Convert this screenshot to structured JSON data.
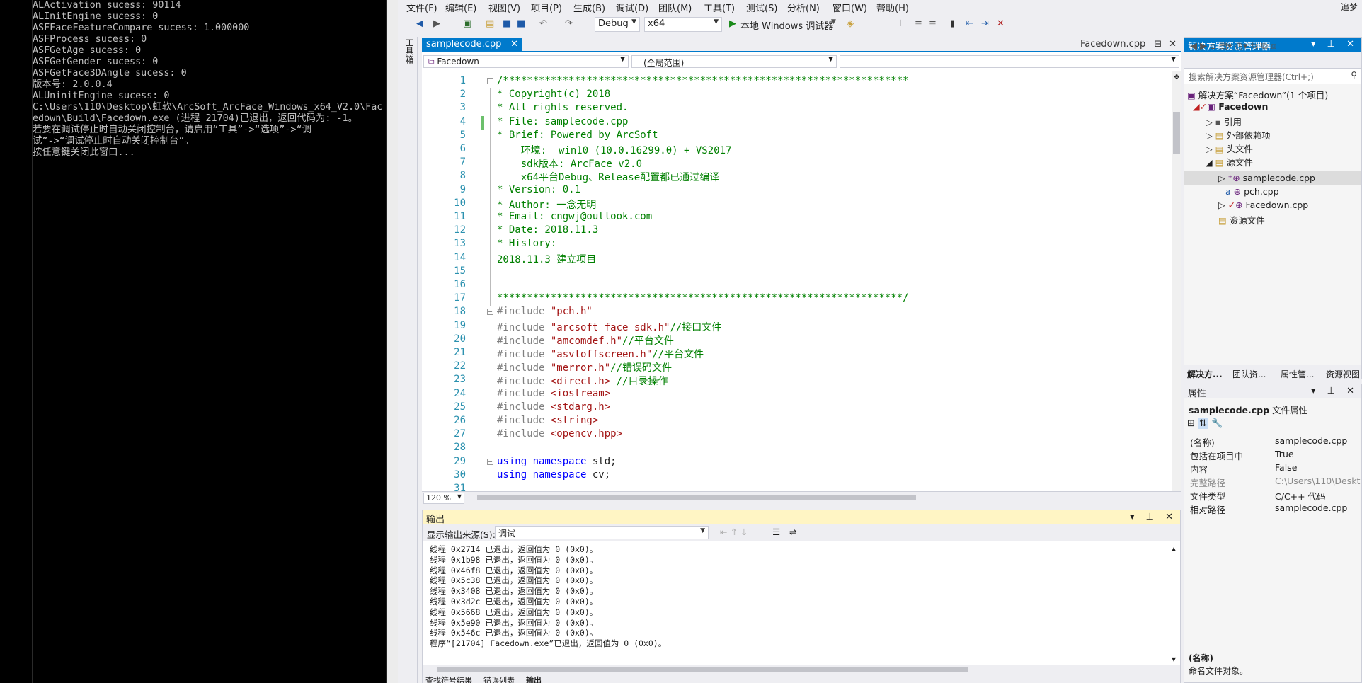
{
  "console": {
    "lines": [
      "ALActivation sucess: 90114",
      "ALInitEngine sucess: 0",
      "ASFFaceFeatureCompare sucess: 1.000000",
      "ASFProcess sucess: 0",
      "ASFGetAge sucess: 0",
      "ASFGetGender sucess: 0",
      "ASFGetFace3DAngle sucess: 0",
      "版本号: 2.0.0.4",
      "ALUninitEngine sucess: 0",
      "",
      "C:\\Users\\110\\Desktop\\虹软\\ArcSoft_ArcFace_Windows_x64_V2.0\\Fac",
      "edown\\Build\\Facedown.exe (进程 21704)已退出，返回代码为: -1。",
      "若要在调试停止时自动关闭控制台，请启用“工具”->“选项”->“调",
      "试”->“调试停止时自动关闭控制台”。",
      "按任意键关闭此窗口..."
    ]
  },
  "menu": [
    "文件(F)",
    "编辑(E)",
    "视图(V)",
    "项目(P)",
    "生成(B)",
    "调试(D)",
    "团队(M)",
    "工具(T)",
    "测试(S)",
    "分析(N)",
    "窗口(W)",
    "帮助(H)"
  ],
  "user": "追梦",
  "toolbar": {
    "config": "Debug",
    "platform": "x64",
    "run": "本地 Windows 调试器"
  },
  "toolstrip": "工具箱",
  "editor": {
    "tab_active": "samplecode.cpp",
    "tab_other": "Facedown.cpp",
    "nav_project": "Facedown",
    "nav_scope": "(全局范围)",
    "zoom": "120 %",
    "lines": [
      {
        "n": "1",
        "t": "/********************************************************************",
        "c": "cm"
      },
      {
        "n": "2",
        "t": "* Copyright(c) 2018",
        "c": "cm"
      },
      {
        "n": "3",
        "t": "* All rights reserved.",
        "c": "cm"
      },
      {
        "n": "4",
        "t": "* File: samplecode.cpp",
        "c": "cm"
      },
      {
        "n": "5",
        "t": "* Brief: Powered by ArcSoft",
        "c": "cm"
      },
      {
        "n": "6",
        "t": "    环境:  win10 (10.0.16299.0) + VS2017",
        "c": "cm"
      },
      {
        "n": "7",
        "t": "    sdk版本: ArcFace v2.0",
        "c": "cm"
      },
      {
        "n": "8",
        "t": "    x64平台Debug、Release配置都已通过编译",
        "c": "cm"
      },
      {
        "n": "9",
        "t": "* Version: 0.1",
        "c": "cm"
      },
      {
        "n": "10",
        "t": "* Author: 一念无明",
        "c": "cm"
      },
      {
        "n": "11",
        "t": "* Email: cngwj@outlook.com",
        "c": "cm"
      },
      {
        "n": "12",
        "t": "* Date: 2018.11.3",
        "c": "cm"
      },
      {
        "n": "13",
        "t": "* History:",
        "c": "cm"
      },
      {
        "n": "14",
        "t": "2018.11.3 建立项目",
        "c": "cm"
      },
      {
        "n": "15",
        "t": "",
        "c": "cm"
      },
      {
        "n": "16",
        "t": "",
        "c": "cm"
      },
      {
        "n": "17",
        "t": "********************************************************************/",
        "c": "cm"
      },
      {
        "n": "18",
        "a": "#include ",
        "b": "\"pch.h\"",
        "d": ""
      },
      {
        "n": "19",
        "a": "#include ",
        "b": "\"arcsoft_face_sdk.h\"",
        "d": "//接口文件"
      },
      {
        "n": "20",
        "a": "#include ",
        "b": "\"amcomdef.h\"",
        "d": "//平台文件"
      },
      {
        "n": "21",
        "a": "#include ",
        "b": "\"asvloffscreen.h\"",
        "d": "//平台文件"
      },
      {
        "n": "22",
        "a": "#include ",
        "b": "\"merror.h\"",
        "d": "//错误码文件"
      },
      {
        "n": "23",
        "a": "#include ",
        "b": "<direct.h>",
        "d": " //目录操作"
      },
      {
        "n": "24",
        "a": "#include ",
        "b": "<iostream>",
        "d": ""
      },
      {
        "n": "25",
        "a": "#include ",
        "b": "<stdarg.h>",
        "d": ""
      },
      {
        "n": "26",
        "a": "#include ",
        "b": "<string>",
        "d": ""
      },
      {
        "n": "27",
        "a": "#include ",
        "b": "<opencv.hpp>",
        "d": ""
      },
      {
        "n": "28",
        "t": "",
        "c": "nm"
      },
      {
        "n": "29",
        "k": "using namespace",
        "r": " std;"
      },
      {
        "n": "30",
        "k": "using namespace",
        "r": " cv;"
      },
      {
        "n": "31",
        "t": "",
        "c": "nm"
      }
    ]
  },
  "solution": {
    "title": "解决方案资源管理器",
    "search": "搜索解决方案资源管理器(Ctrl+;)",
    "items": [
      "解决方案“Facedown”(1 个项目)",
      "Facedown",
      "引用",
      "外部依赖项",
      "头文件",
      "源文件",
      "samplecode.cpp",
      "pch.cpp",
      "Facedown.cpp",
      "资源文件"
    ],
    "tabs": [
      "解决方...",
      "团队资...",
      "属性管...",
      "资源视图"
    ]
  },
  "properties": {
    "title": "属性",
    "file": "samplecode.cpp",
    "file_suffix": "文件属性",
    "rows": [
      {
        "k": "(名称)",
        "v": "samplecode.cpp"
      },
      {
        "k": "包括在项目中",
        "v": "True"
      },
      {
        "k": "内容",
        "v": "False"
      },
      {
        "k": "完整路径",
        "v": "C:\\Users\\110\\Deskt"
      },
      {
        "k": "文件类型",
        "v": "C/C++ 代码"
      },
      {
        "k": "相对路径",
        "v": "samplecode.cpp"
      }
    ],
    "desc_title": "(名称)",
    "desc": "命名文件对象。"
  },
  "output": {
    "title": "输出",
    "source_label": "显示输出来源(S):",
    "source": "调试",
    "lines": [
      "线程 0x2714 已退出，返回值为 0 (0x0)。",
      "线程 0x1b98 已退出，返回值为 0 (0x0)。",
      "线程 0x46f8 已退出，返回值为 0 (0x0)。",
      "线程 0x5c38 已退出，返回值为 0 (0x0)。",
      "线程 0x3408 已退出，返回值为 0 (0x0)。",
      "线程 0x3d2c 已退出，返回值为 0 (0x0)。",
      "线程 0x5668 已退出，返回值为 0 (0x0)。",
      "线程 0x5e90 已退出，返回值为 0 (0x0)。",
      "线程 0x546c 已退出，返回值为 0 (0x0)。",
      "程序“[21704] Facedown.exe”已退出，返回值为 0 (0x0)。"
    ],
    "tabs": [
      "查找符号结果",
      "错误列表",
      "输出"
    ]
  }
}
